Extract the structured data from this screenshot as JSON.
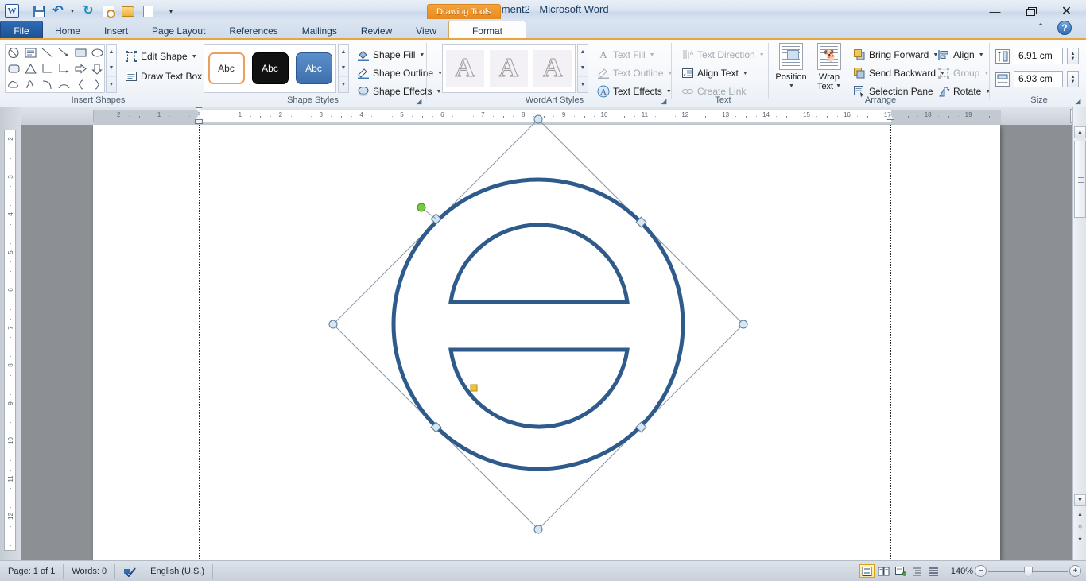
{
  "titlebar": {
    "document_title": "Document2  -  Microsoft Word",
    "quick_access": [
      {
        "name": "word-logo",
        "icon": "W"
      },
      {
        "name": "save",
        "label": "Save"
      },
      {
        "name": "undo",
        "label": "Undo"
      },
      {
        "name": "redo",
        "label": "Redo"
      },
      {
        "name": "print-preview",
        "label": "Print Preview"
      },
      {
        "name": "open",
        "label": "Open"
      },
      {
        "name": "new",
        "label": "New"
      },
      {
        "name": "customize",
        "label": "Customize Quick Access Toolbar"
      }
    ],
    "window_controls": {
      "minimize": "—",
      "restore": "Restore",
      "close": "✕"
    },
    "help_label": "?",
    "collapse_ribbon_label": "⌃"
  },
  "contextual": {
    "label": "Drawing Tools"
  },
  "tabs": [
    {
      "label": "File"
    },
    {
      "label": "Home"
    },
    {
      "label": "Insert"
    },
    {
      "label": "Page Layout"
    },
    {
      "label": "References"
    },
    {
      "label": "Mailings"
    },
    {
      "label": "Review"
    },
    {
      "label": "View"
    },
    {
      "label": "Format"
    }
  ],
  "ribbon": {
    "insert_shapes": {
      "title": "Insert Shapes",
      "edit_shape": "Edit Shape",
      "draw_text_box": "Draw Text Box",
      "scroll": [
        "▲",
        "▼",
        "▼"
      ]
    },
    "shape_styles": {
      "title": "Shape Styles",
      "thumbs": [
        "Abc",
        "Abc",
        "Abc"
      ],
      "shape_fill": "Shape Fill",
      "shape_outline": "Shape Outline",
      "shape_effects": "Shape Effects",
      "scroll": [
        "▲",
        "▼",
        "▼"
      ],
      "dialog_launcher": "◢"
    },
    "wordart_styles": {
      "title": "WordArt Styles",
      "thumbs": [
        "A",
        "A",
        "A"
      ],
      "text_fill": "Text Fill",
      "text_outline": "Text Outline",
      "text_effects": "Text Effects",
      "scroll": [
        "▲",
        "▼",
        "▼"
      ],
      "dialog_launcher": "◢"
    },
    "text": {
      "title": "Text",
      "text_direction": "Text Direction",
      "align_text": "Align Text",
      "create_link": "Create Link"
    },
    "arrange": {
      "title": "Arrange",
      "position": "Position",
      "wrap_text": "Wrap\nText",
      "wrap_text_line1": "Wrap",
      "wrap_text_line2": "Text",
      "bring_forward": "Bring Forward",
      "send_backward": "Send Backward",
      "selection_pane": "Selection Pane",
      "align": "Align",
      "group": "Group",
      "rotate": "Rotate"
    },
    "size": {
      "title": "Size",
      "height_value": "6.91 cm",
      "width_value": "6.93 cm",
      "dialog_launcher": "◢"
    }
  },
  "rulers": {
    "tab_selector": "L",
    "horizontal_numbers": [
      "2",
      "1",
      "1",
      "2",
      "3",
      "4",
      "5",
      "6",
      "7",
      "8",
      "9",
      "10",
      "11",
      "12",
      "13",
      "14",
      "15",
      "16",
      "17",
      "18",
      "19"
    ],
    "vertical_numbers": [
      "2",
      "3",
      "4",
      "5",
      "6",
      "7",
      "8",
      "9",
      "10",
      "11",
      "12"
    ]
  },
  "shape": {
    "name": "sun-circle-with-two-chords",
    "outline_color": "#2E5A8C",
    "fill": "none",
    "stroke_width": 5,
    "rotation_degrees": 45,
    "handles": {
      "corner_color": "#d6e6f2",
      "rotation_color": "#7ac943",
      "adjust_color": "#f2c12e",
      "frame_color": "#8d98a6"
    }
  },
  "scrollbar": {
    "up_arrow": "▲",
    "down_arrow": "▼",
    "prev_page": "▴",
    "select_object": "○",
    "next_page": "▾",
    "select_browse_object": "select-browse-object"
  },
  "statusbar": {
    "page": "Page: 1 of 1",
    "words": "Words: 0",
    "language": "English (U.S.)",
    "proofing_icon": "proofing-errors-icon",
    "view_buttons": [
      {
        "name": "print-layout",
        "glyph": "▤",
        "active": true
      },
      {
        "name": "full-screen-reading",
        "glyph": "ᴘ",
        "active": false
      },
      {
        "name": "web-layout",
        "glyph": "▥",
        "active": false
      },
      {
        "name": "outline",
        "glyph": "≣",
        "active": false
      },
      {
        "name": "draft",
        "glyph": "☰",
        "active": false
      }
    ],
    "zoom_level": "140%",
    "zoom_out": "−",
    "zoom_in": "+"
  }
}
